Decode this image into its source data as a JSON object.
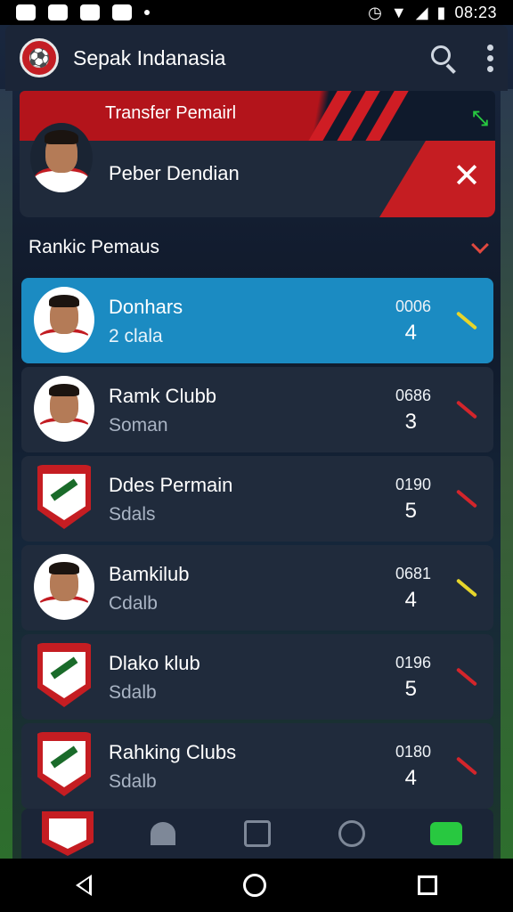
{
  "status_bar": {
    "time": "08:23"
  },
  "app": {
    "title": "Sepak Indanasia"
  },
  "transfer": {
    "label": "Transfer Pemairl",
    "player_name": "Peber Dendian",
    "close_glyph": "✕"
  },
  "section": {
    "title": "Rankic Pemaus"
  },
  "rows": [
    {
      "title": "Donhars",
      "subtitle": "2 clala",
      "code": "0006",
      "rank": "4",
      "icon": "player-photo",
      "trend_color": "#e6d52b",
      "active": true
    },
    {
      "title": "Ramk Clubb",
      "subtitle": "Soman",
      "code": "0686",
      "rank": "3",
      "icon": "player-photo",
      "trend_color": "#d3252b",
      "active": false
    },
    {
      "title": "Ddes Permain",
      "subtitle": "Sdals",
      "code": "0190",
      "rank": "5",
      "icon": "club-crest",
      "trend_color": "#d3252b",
      "active": false
    },
    {
      "title": "Bamkilub",
      "subtitle": "Cdalb",
      "code": "0681",
      "rank": "4",
      "icon": "player-photo",
      "trend_color": "#e6d52b",
      "active": false
    },
    {
      "title": "Dlako klub",
      "subtitle": "Sdalb",
      "code": "0196",
      "rank": "5",
      "icon": "club-crest",
      "trend_color": "#d3252b",
      "active": false
    },
    {
      "title": "Rahking Clubs",
      "subtitle": "Sdalb",
      "code": "0180",
      "rank": "4",
      "icon": "club-crest",
      "trend_color": "#d3252b",
      "active": false
    }
  ],
  "bottom_nav": [
    "club-crest-icon",
    "bell-icon",
    "document-icon",
    "players-icon",
    "stats-icon"
  ]
}
